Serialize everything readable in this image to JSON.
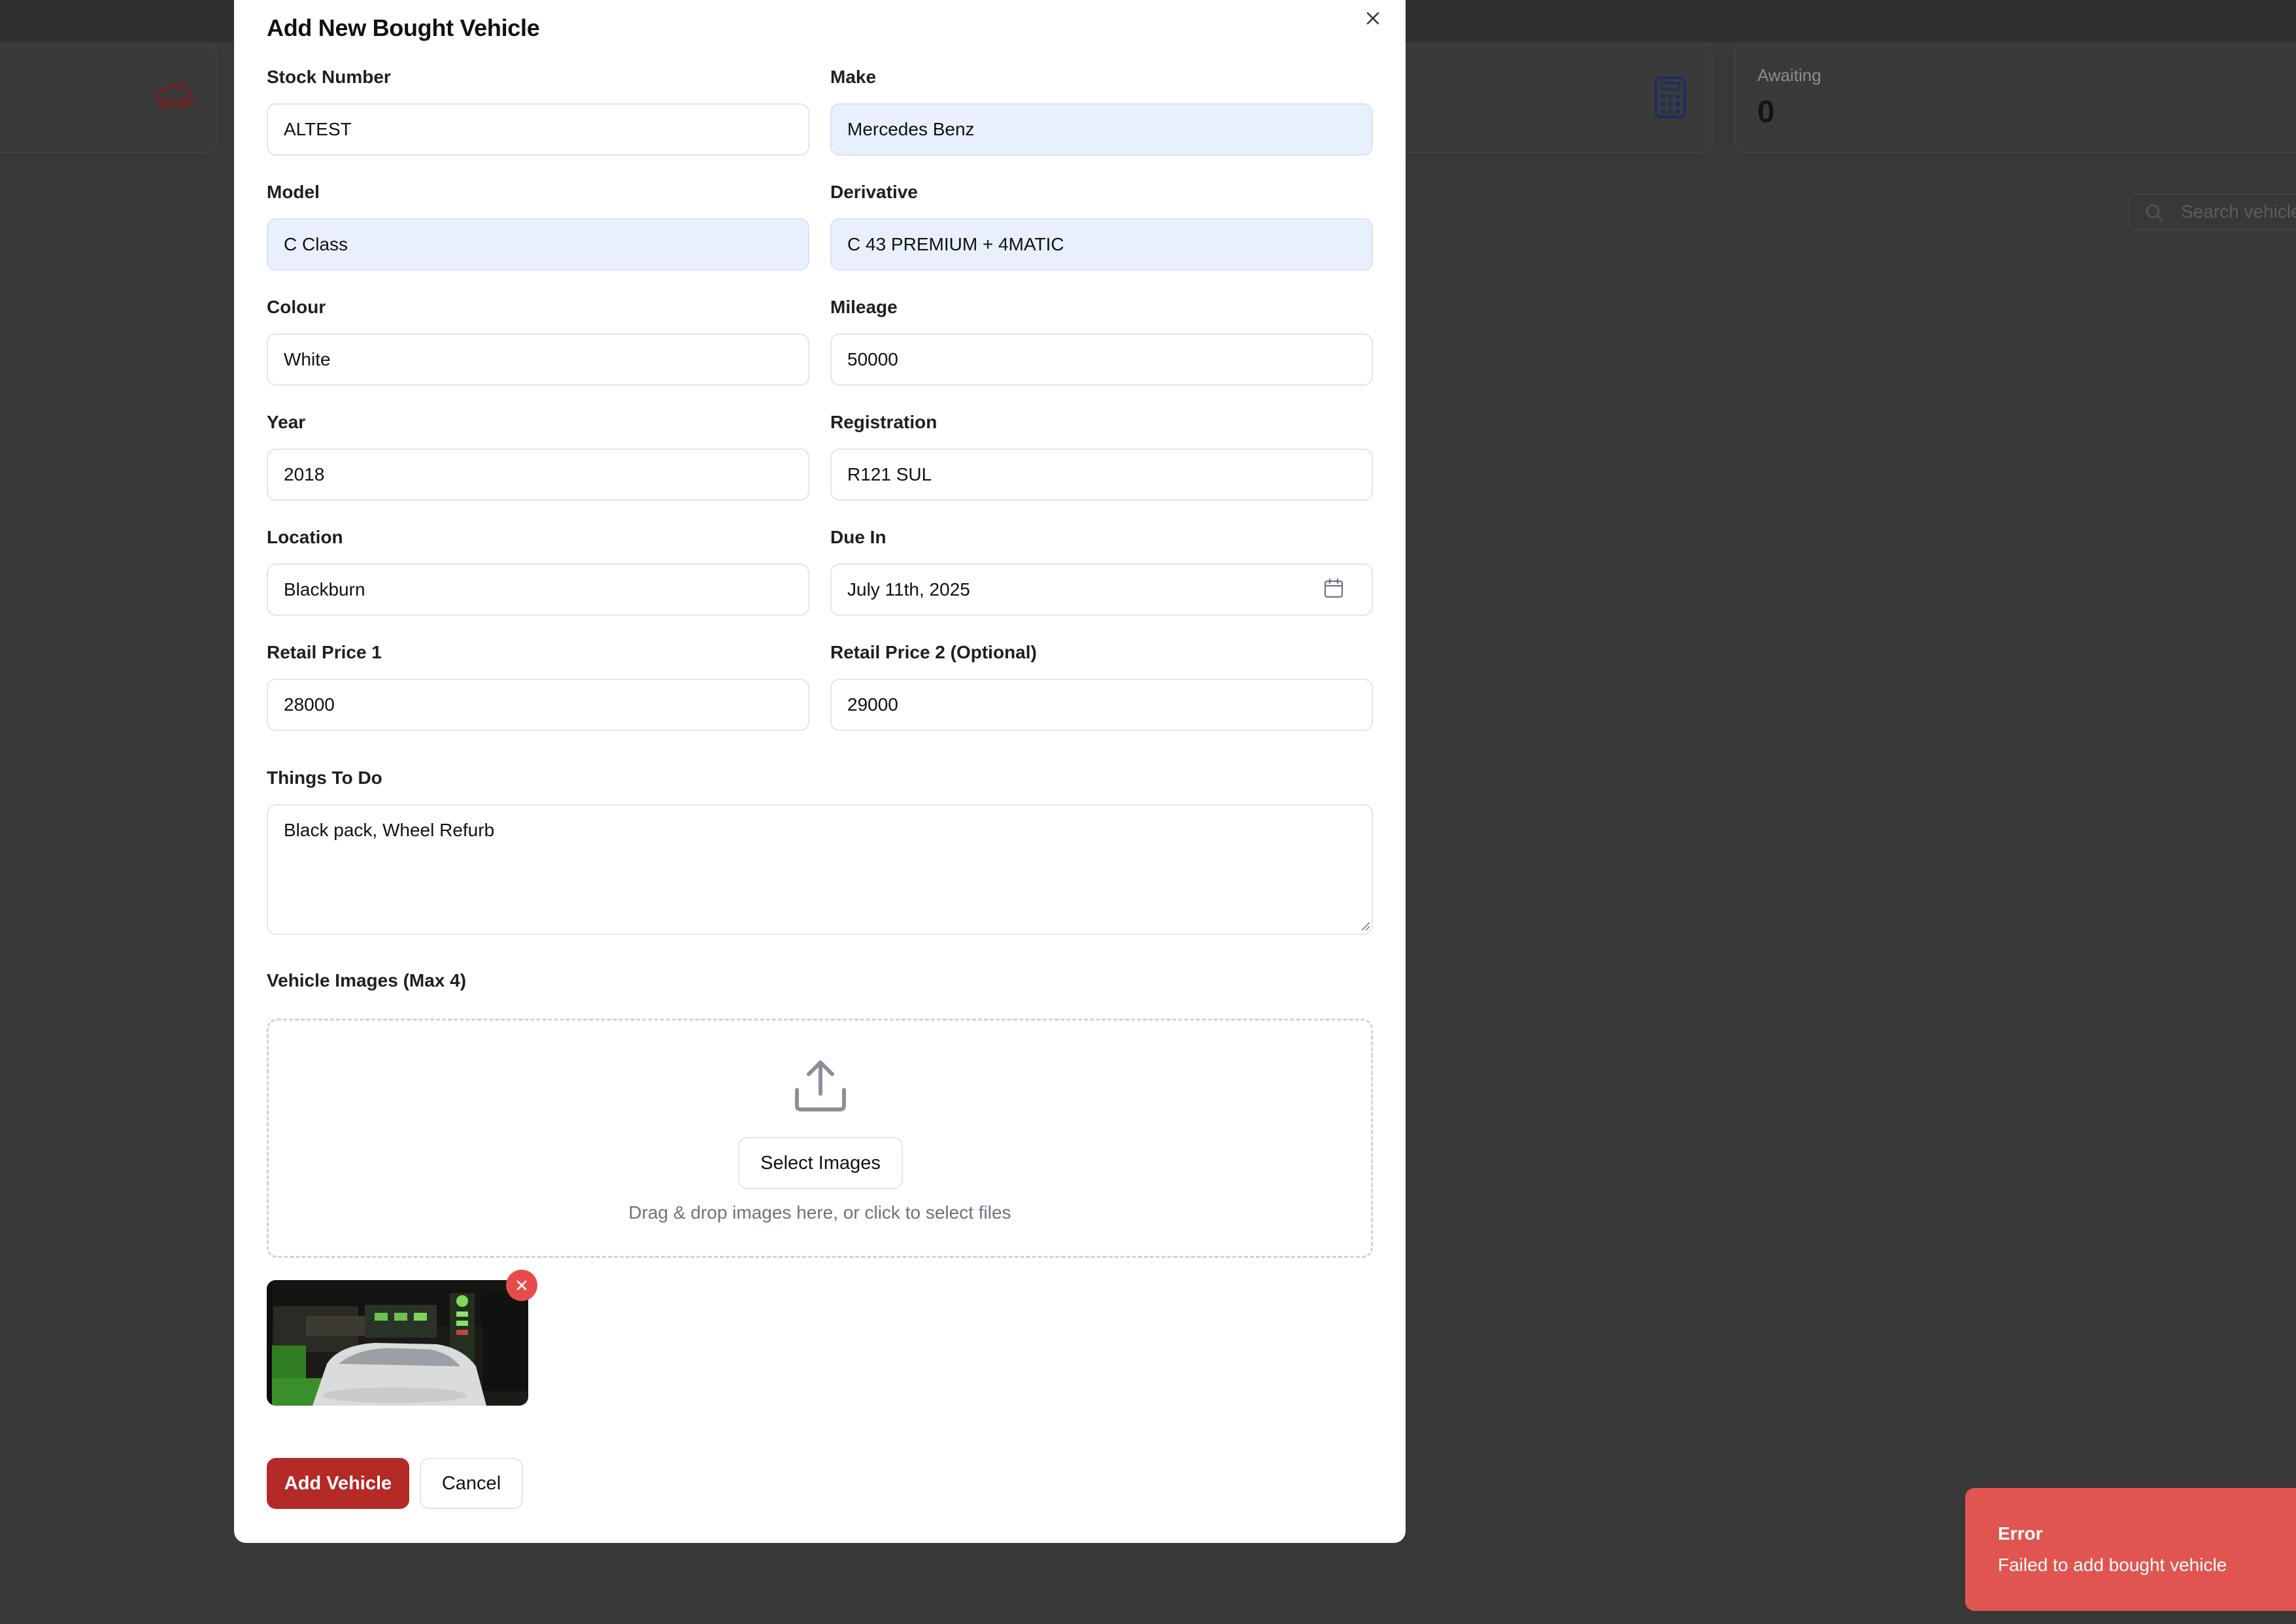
{
  "background": {
    "stat_card": {
      "label": "Awaiting",
      "value": "0"
    },
    "search": {
      "placeholder": "Search vehicles"
    },
    "icons": [
      "car-icon",
      "calculator-icon",
      "search-icon"
    ]
  },
  "modal": {
    "title": "Add New Bought Vehicle",
    "fields": {
      "stock_number": {
        "label": "Stock Number",
        "value": "ALTEST"
      },
      "make": {
        "label": "Make",
        "value": "Mercedes Benz"
      },
      "model": {
        "label": "Model",
        "value": "C Class"
      },
      "derivative": {
        "label": "Derivative",
        "value": "C 43 PREMIUM + 4MATIC"
      },
      "colour": {
        "label": "Colour",
        "value": "White"
      },
      "mileage": {
        "label": "Mileage",
        "value": "50000"
      },
      "year": {
        "label": "Year",
        "value": "2018"
      },
      "registration": {
        "label": "Registration",
        "value": "R121 SUL"
      },
      "location": {
        "label": "Location",
        "value": "Blackburn"
      },
      "due_in": {
        "label": "Due In",
        "value": "July 11th, 2025"
      },
      "retail_price_1": {
        "label": "Retail Price 1",
        "value": "28000"
      },
      "retail_price_2": {
        "label": "Retail Price 2 (Optional)",
        "value": "29000"
      }
    },
    "things_to_do": {
      "label": "Things To Do",
      "value": "Black pack, Wheel Refurb"
    },
    "images": {
      "label": "Vehicle Images (Max 4)",
      "select_button": "Select Images",
      "hint": "Drag & drop images here, or click to select files"
    },
    "buttons": {
      "add": "Add Vehicle",
      "cancel": "Cancel"
    }
  },
  "toast": {
    "title": "Error",
    "message": "Failed to add bought vehicle"
  },
  "colors": {
    "primary": "#b42a26",
    "toast_error": "#e05551",
    "autofill": "#e8f0fe",
    "remove": "#e74c4c"
  }
}
